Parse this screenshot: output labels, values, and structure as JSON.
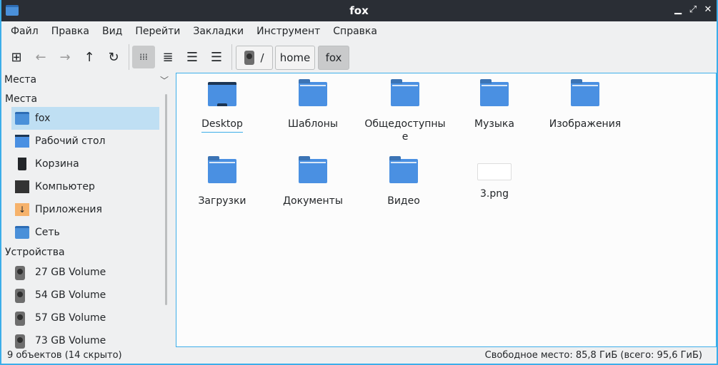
{
  "window": {
    "title": "fox"
  },
  "menu": [
    "Файл",
    "Правка",
    "Вид",
    "Перейти",
    "Закладки",
    "Инструмент",
    "Справка"
  ],
  "breadcrumb": [
    "/",
    "home",
    "fox"
  ],
  "sidebar": {
    "header": "Места",
    "sections": [
      {
        "title": "Места",
        "items": [
          "fox",
          "Рабочий стол",
          "Корзина",
          "Компьютер",
          "Приложения",
          "Сеть"
        ]
      },
      {
        "title": "Устройства",
        "items": [
          "27 GB Volume",
          "54 GB Volume",
          "57 GB Volume",
          "73 GB Volume"
        ]
      }
    ]
  },
  "files": [
    "Desktop",
    "Шаблоны",
    "Общедоступные",
    "Музыка",
    "Изображения",
    "Загрузки",
    "Документы",
    "Видео",
    "3.png"
  ],
  "status": {
    "left": "9 объектов (14 скрыто)",
    "right": "Свободное место: 85,8 ГиБ (всего: 95,6 ГиБ)"
  }
}
